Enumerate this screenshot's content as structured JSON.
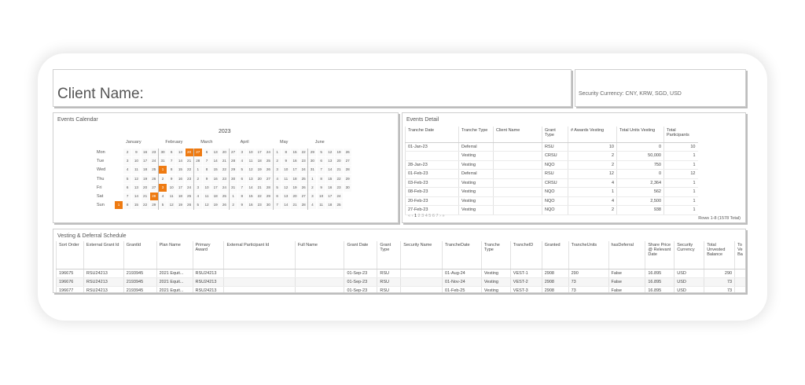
{
  "header": {
    "client_label": "Client Name:",
    "security_currency": "Security Currency: CNY, KRW, SGD, USD"
  },
  "calendar": {
    "title": "Events Calendar",
    "year": "2023",
    "months": [
      "January",
      "February",
      "March",
      "April",
      "May",
      "June"
    ],
    "days": [
      "Mon",
      "Tue",
      "Wed",
      "Thu",
      "Fri",
      "Sat",
      "Sun"
    ],
    "event_dates": [
      "2023-01-01",
      "2023-01-28",
      "2023-02-01",
      "2023-02-03",
      "2023-02-20",
      "2023-02-27"
    ]
  },
  "events_detail": {
    "title": "Events Detail",
    "columns": [
      "Tranche Date",
      "Tranche Type",
      "Client Name",
      "Grant Type",
      "# Awards Vesting",
      "Total Units Vesting",
      "Total Participants"
    ],
    "rows": [
      [
        "01-Jan-23",
        "Deferral",
        "",
        "RSU",
        "10",
        "0",
        "10"
      ],
      [
        "",
        "Vesting",
        "",
        "CRSU",
        "2",
        "50,000",
        "1"
      ],
      [
        "28-Jan-23",
        "Vesting",
        "",
        "NQO",
        "2",
        "750",
        "1"
      ],
      [
        "01-Feb-23",
        "Deferral",
        "",
        "RSU",
        "12",
        "0",
        "12"
      ],
      [
        "03-Feb-23",
        "Vesting",
        "",
        "CRSU",
        "4",
        "2,364",
        "1"
      ],
      [
        "08-Feb-23",
        "Vesting",
        "",
        "NQO",
        "1",
        "562",
        "1"
      ],
      [
        "20-Feb-23",
        "Vesting",
        "",
        "NQO",
        "4",
        "2,500",
        "1"
      ],
      [
        "27-Feb-23",
        "Vesting",
        "",
        "NQO",
        "2",
        "938",
        "1"
      ]
    ],
    "pager": {
      "prev": "«  ‹",
      "current": "1",
      "pages": "2 3 4 5 6 7",
      "next": "›  »"
    },
    "rows_info": "Rows 1-8 (1578 Total)"
  },
  "vesting_schedule": {
    "title": "Vesting & Deferral Schedule",
    "columns": [
      "Sort Order",
      "External Grant Id",
      "GrantId",
      "Plan Name",
      "Primary Award",
      "External Participant Id",
      "Full Name",
      "Grant Date",
      "Grant Type",
      "Security Name",
      "TrancheDate",
      "Tranche Type",
      "TrancheID",
      "Granted",
      "TrancheUnits",
      "hasDeferral",
      "Share Price @ Relevant Date",
      "Security Currency",
      "Total Unvested Balance",
      "To Ve Ba"
    ],
    "rows": [
      [
        "196675",
        "RSU24213",
        "2193945",
        "2021 Equit...",
        "RSU24213",
        "",
        "",
        "01-Sep-23",
        "RSU",
        "",
        "01-Aug-24",
        "Vesting",
        "VEST-1",
        "2908",
        "290",
        "False",
        "16.895",
        "USD",
        "290",
        ""
      ],
      [
        "196676",
        "RSU24213",
        "2193945",
        "2021 Equit...",
        "RSU24213",
        "",
        "",
        "01-Sep-23",
        "RSU",
        "",
        "01-Nov-24",
        "Vesting",
        "VEST-2",
        "2908",
        "73",
        "False",
        "16.895",
        "USD",
        "73",
        ""
      ],
      [
        "196677",
        "RSU24213",
        "2193945",
        "2021 Equit...",
        "RSU24213",
        "",
        "",
        "01-Sep-23",
        "RSU",
        "",
        "01-Feb-25",
        "Vesting",
        "VEST-3",
        "2908",
        "73",
        "False",
        "16.895",
        "USD",
        "73",
        ""
      ]
    ]
  },
  "colors": {
    "event_highlight": "#ee7a11",
    "panel_border": "#cfcfcf"
  }
}
